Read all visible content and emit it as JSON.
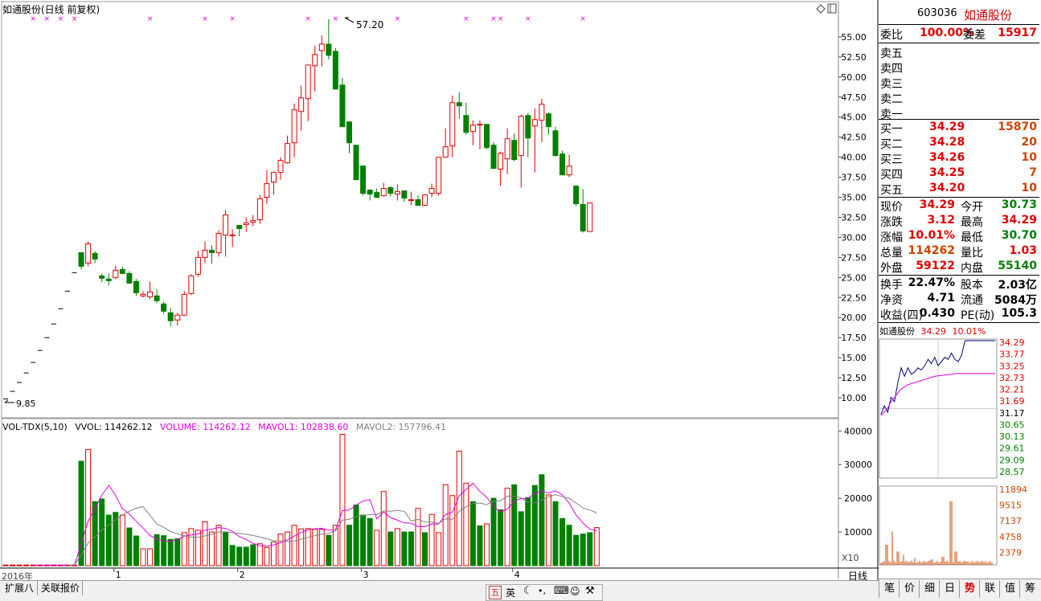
{
  "stock": {
    "code": "603036",
    "name": "如通股份"
  },
  "chart_title": "如通股份(日线 前复权)",
  "price_axis": [
    "55.00",
    "52.50",
    "50.00",
    "47.50",
    "45.00",
    "42.50",
    "40.00",
    "37.50",
    "35.00",
    "32.50",
    "30.00",
    "27.50",
    "25.00",
    "22.50",
    "20.00",
    "17.50",
    "15.00",
    "12.50",
    "10.00"
  ],
  "annotations": {
    "high": "57.20",
    "low": "9.85"
  },
  "volume_indicator": {
    "name": "VOL-TDX(5,10)",
    "vvol": "VVOL: 114262.12",
    "volume": "VOLUME: 114262.12",
    "mavol1": "MAVOL1: 102838.60",
    "mavol2": "MAVOL2: 157796.41"
  },
  "volume_axis": [
    "40000",
    "30000",
    "20000",
    "10000"
  ],
  "volume_scale": "X10",
  "x_axis": {
    "year_label": "2016年",
    "months": [
      "1",
      "2",
      "3",
      "4"
    ],
    "period_label": "日线"
  },
  "bottom_tabs": [
    "扩展八",
    "关联报价"
  ],
  "ime": {
    "label1": "五",
    "label2": "英"
  },
  "order_book": {
    "weibi_label": "委比",
    "weibi": "100.00%",
    "weicha_label": "委差",
    "weicha": "15917",
    "sells": [
      {
        "label": "卖五"
      },
      {
        "label": "卖四"
      },
      {
        "label": "卖三"
      },
      {
        "label": "卖二"
      },
      {
        "label": "卖一"
      }
    ],
    "buys": [
      {
        "label": "买一",
        "price": "34.29",
        "vol": "15870"
      },
      {
        "label": "买二",
        "price": "34.28",
        "vol": "20"
      },
      {
        "label": "买三",
        "price": "34.26",
        "vol": "10"
      },
      {
        "label": "买四",
        "price": "34.25",
        "vol": "7"
      },
      {
        "label": "买五",
        "price": "34.20",
        "vol": "10"
      }
    ]
  },
  "quote": [
    {
      "l1": "现价",
      "v1": "34.29",
      "l2": "今开",
      "v2": "30.73",
      "c1": "#e00000",
      "c2": "#008000"
    },
    {
      "l1": "涨跌",
      "v1": "3.12",
      "l2": "最高",
      "v2": "34.29",
      "c1": "#e00000",
      "c2": "#e00000"
    },
    {
      "l1": "涨幅",
      "v1": "10.01%",
      "l2": "最低",
      "v2": "30.70",
      "c1": "#e00000",
      "c2": "#008000"
    },
    {
      "l1": "总量",
      "v1": "114262",
      "l2": "量比",
      "v2": "1.03",
      "c1": "#cc4400",
      "c2": "#e00000"
    },
    {
      "l1": "外盘",
      "v1": "59122",
      "l2": "内盘",
      "v2": "55140",
      "c1": "#e00000",
      "c2": "#008000"
    }
  ],
  "fundamentals": [
    {
      "l1": "换手",
      "v1": "22.47%",
      "l2": "股本",
      "v2": "2.03亿"
    },
    {
      "l1": "净资",
      "v1": "4.71",
      "l2": "流通",
      "v2": "5084万"
    },
    {
      "l1": "收益(四)",
      "v1": "0.430",
      "l2": "PE(动)",
      "v2": "105.3"
    }
  ],
  "intraday": {
    "header_name": "如通股份",
    "header_price": "34.29",
    "header_pct": "10.01%",
    "price_axis": [
      "34.29",
      "33.77",
      "33.25",
      "32.73",
      "32.21",
      "31.69",
      "31.17",
      "30.65",
      "30.13",
      "29.61",
      "29.09",
      "28.57"
    ],
    "vol_axis": [
      "11894",
      "9515",
      "7137",
      "4758",
      "2379"
    ]
  },
  "bottom_buttons": [
    "笔",
    "价",
    "细",
    "日",
    "势",
    "联",
    "值",
    "筹"
  ],
  "colors": {
    "up": "#e00000",
    "down": "#008000",
    "mavol1": "#e000e0",
    "mavol2": "#808080"
  },
  "chart_data": {
    "type": "candlestick",
    "ohlc_note": "daily candles, approximate",
    "candles": [
      [
        9.85,
        9.85,
        9.85,
        9.85
      ],
      [
        10.8,
        10.8,
        10.8,
        10.8
      ],
      [
        11.9,
        11.9,
        11.9,
        11.9
      ],
      [
        13.1,
        13.1,
        13.1,
        13.1
      ],
      [
        14.4,
        14.4,
        14.4,
        14.4
      ],
      [
        15.9,
        15.9,
        15.9,
        15.9
      ],
      [
        17.5,
        17.5,
        17.5,
        17.5
      ],
      [
        19.2,
        19.2,
        19.2,
        19.2
      ],
      [
        21.1,
        21.1,
        21.1,
        21.1
      ],
      [
        23.3,
        23.3,
        23.3,
        23.3
      ],
      [
        25.6,
        25.6,
        25.6,
        25.6
      ],
      [
        28.1,
        27.5,
        26.0,
        26.4
      ],
      [
        26.8,
        29.5,
        26.4,
        29.2
      ],
      [
        28.0,
        28.3,
        26.8,
        27.3
      ],
      [
        25.2,
        25.5,
        24.4,
        24.9
      ],
      [
        24.8,
        25.5,
        24.0,
        24.6
      ],
      [
        25.0,
        26.5,
        24.8,
        25.9
      ],
      [
        26.0,
        26.3,
        25.4,
        25.5
      ],
      [
        25.5,
        25.8,
        24.2,
        24.3
      ],
      [
        24.5,
        24.8,
        22.7,
        23.1
      ],
      [
        22.7,
        23.3,
        22.5,
        22.9
      ],
      [
        22.6,
        24.5,
        22.3,
        23.2
      ],
      [
        22.7,
        23.5,
        21.8,
        22.1
      ],
      [
        21.7,
        22.0,
        20.5,
        20.8
      ],
      [
        20.6,
        21.2,
        18.9,
        19.6
      ],
      [
        19.7,
        20.6,
        19.0,
        20.3
      ],
      [
        20.3,
        23.3,
        20.2,
        22.9
      ],
      [
        23.0,
        25.4,
        22.8,
        25.2
      ],
      [
        25.4,
        28.3,
        25.1,
        27.5
      ],
      [
        27.5,
        29.5,
        26.8,
        28.4
      ],
      [
        28.4,
        29.0,
        26.7,
        28.1
      ],
      [
        28.1,
        30.9,
        27.6,
        30.5
      ],
      [
        30.3,
        33.4,
        27.6,
        32.8
      ],
      [
        30.3,
        31.0,
        28.8,
        30.3
      ],
      [
        31.5,
        31.5,
        30.1,
        31.1
      ],
      [
        31.6,
        32.5,
        30.7,
        31.8
      ],
      [
        31.9,
        32.8,
        31.4,
        32.1
      ],
      [
        32.2,
        35.3,
        31.7,
        34.8
      ],
      [
        35.0,
        38.4,
        34.2,
        36.7
      ],
      [
        36.9,
        38.2,
        35.3,
        38.1
      ],
      [
        38.1,
        40.0,
        37.2,
        39.6
      ],
      [
        39.3,
        42.7,
        39.2,
        41.7
      ],
      [
        41.8,
        46.7,
        40.0,
        45.9
      ],
      [
        45.7,
        48.9,
        43.3,
        47.4
      ],
      [
        47.3,
        50.9,
        44.5,
        51.5
      ],
      [
        51.4,
        53.9,
        48.2,
        52.8
      ],
      [
        53.3,
        55.2,
        51.3,
        54.1
      ],
      [
        54.1,
        57.2,
        52.2,
        52.7
      ],
      [
        53.2,
        53.6,
        49.9,
        48.5
      ],
      [
        49.0,
        49.9,
        47.3,
        43.8
      ],
      [
        44.4,
        44.5,
        40.5,
        41.8
      ],
      [
        41.5,
        41.4,
        37.1,
        37.2
      ],
      [
        38.9,
        37.1,
        35.2,
        35.5
      ],
      [
        35.9,
        36.0,
        34.6,
        35.4
      ],
      [
        35.6,
        36.1,
        34.9,
        35.0
      ],
      [
        35.2,
        36.8,
        35.1,
        36.1
      ],
      [
        36.2,
        36.4,
        35.1,
        35.5
      ],
      [
        35.4,
        36.6,
        34.6,
        35.7
      ],
      [
        35.8,
        35.8,
        34.4,
        34.9
      ],
      [
        34.6,
        35.7,
        34.0,
        34.7
      ],
      [
        34.7,
        35.3,
        33.9,
        34.0
      ],
      [
        34.0,
        35.4,
        33.9,
        35.3
      ],
      [
        35.5,
        36.7,
        35.0,
        36.1
      ],
      [
        35.5,
        40.0,
        35.2,
        40.0
      ],
      [
        40.0,
        43.6,
        40.2,
        41.3
      ],
      [
        41.4,
        47.7,
        40.0,
        46.8
      ],
      [
        46.8,
        48.1,
        44.8,
        46.4
      ],
      [
        45.2,
        46.8,
        42.8,
        43.1
      ],
      [
        43.2,
        44.6,
        41.5,
        44.0
      ],
      [
        44.1,
        44.6,
        41.0,
        44.1
      ],
      [
        44.1,
        44.0,
        41.0,
        41.2
      ],
      [
        41.5,
        41.9,
        38.6,
        38.6
      ],
      [
        38.5,
        40.7,
        36.4,
        40.5
      ],
      [
        39.8,
        43.6,
        37.9,
        42.3
      ],
      [
        42.1,
        43.0,
        39.5,
        39.7
      ],
      [
        40.2,
        45.3,
        36.2,
        45.1
      ],
      [
        45.2,
        45.5,
        40.0,
        42.4
      ],
      [
        43.9,
        46.1,
        38.1,
        44.7
      ],
      [
        44.6,
        47.3,
        41.9,
        46.6
      ],
      [
        45.4,
        45.6,
        42.8,
        43.8
      ],
      [
        43.3,
        43.8,
        40.1,
        40.2
      ],
      [
        40.4,
        40.8,
        37.7,
        37.8
      ],
      [
        37.8,
        40.3,
        37.5,
        38.9
      ],
      [
        36.4,
        36.1,
        33.9,
        34.2
      ],
      [
        34.1,
        36.0,
        30.6,
        30.8
      ],
      [
        30.73,
        34.29,
        30.7,
        34.29
      ]
    ],
    "volume": [
      [
        200,
        "u"
      ],
      [
        200,
        "u"
      ],
      [
        200,
        "u"
      ],
      [
        200,
        "u"
      ],
      [
        200,
        "u"
      ],
      [
        200,
        "u"
      ],
      [
        200,
        "u"
      ],
      [
        200,
        "u"
      ],
      [
        200,
        "u"
      ],
      [
        200,
        "u"
      ],
      [
        200,
        "u"
      ],
      [
        31000,
        "d"
      ],
      [
        34500,
        "u"
      ],
      [
        19000,
        "d"
      ],
      [
        19800,
        "d"
      ],
      [
        15000,
        "d"
      ],
      [
        15800,
        "d"
      ],
      [
        15000,
        "u"
      ],
      [
        11200,
        "d"
      ],
      [
        8800,
        "d"
      ],
      [
        5000,
        "u"
      ],
      [
        5000,
        "u"
      ],
      [
        9200,
        "d"
      ],
      [
        8900,
        "d"
      ],
      [
        7800,
        "d"
      ],
      [
        8000,
        "d"
      ],
      [
        9800,
        "u"
      ],
      [
        11000,
        "u"
      ],
      [
        10500,
        "u"
      ],
      [
        13000,
        "u"
      ],
      [
        10000,
        "u"
      ],
      [
        12000,
        "u"
      ],
      [
        9800,
        "d"
      ],
      [
        6000,
        "d"
      ],
      [
        5500,
        "d"
      ],
      [
        5500,
        "d"
      ],
      [
        6200,
        "d"
      ],
      [
        6500,
        "u"
      ],
      [
        5400,
        "u"
      ],
      [
        7000,
        "u"
      ],
      [
        9400,
        "u"
      ],
      [
        10000,
        "u"
      ],
      [
        12000,
        "u"
      ],
      [
        10900,
        "u"
      ],
      [
        11000,
        "u"
      ],
      [
        10800,
        "u"
      ],
      [
        10800,
        "u"
      ],
      [
        9000,
        "d"
      ],
      [
        12000,
        "u"
      ],
      [
        39000,
        "u"
      ],
      [
        12000,
        "d"
      ],
      [
        18000,
        "d"
      ],
      [
        15000,
        "d"
      ],
      [
        14000,
        "d"
      ],
      [
        10500,
        "u"
      ],
      [
        22000,
        "u"
      ],
      [
        10000,
        "d"
      ],
      [
        11000,
        "u"
      ],
      [
        10000,
        "d"
      ],
      [
        10000,
        "d"
      ],
      [
        17000,
        "u"
      ],
      [
        9800,
        "d"
      ],
      [
        15200,
        "u"
      ],
      [
        9800,
        "u"
      ],
      [
        24000,
        "u"
      ],
      [
        20800,
        "u"
      ],
      [
        34000,
        "u"
      ],
      [
        24500,
        "u"
      ],
      [
        19000,
        "d"
      ],
      [
        11800,
        "d"
      ],
      [
        12400,
        "u"
      ],
      [
        20000,
        "d"
      ],
      [
        16600,
        "d"
      ],
      [
        23000,
        "u"
      ],
      [
        24000,
        "d"
      ],
      [
        16000,
        "d"
      ],
      [
        20200,
        "d"
      ],
      [
        23800,
        "d"
      ],
      [
        27000,
        "d"
      ],
      [
        21000,
        "u"
      ],
      [
        19000,
        "d"
      ],
      [
        14000,
        "d"
      ],
      [
        12000,
        "d"
      ],
      [
        9000,
        "d"
      ],
      [
        9400,
        "d"
      ],
      [
        9800,
        "d"
      ],
      [
        11300,
        "u"
      ]
    ]
  }
}
